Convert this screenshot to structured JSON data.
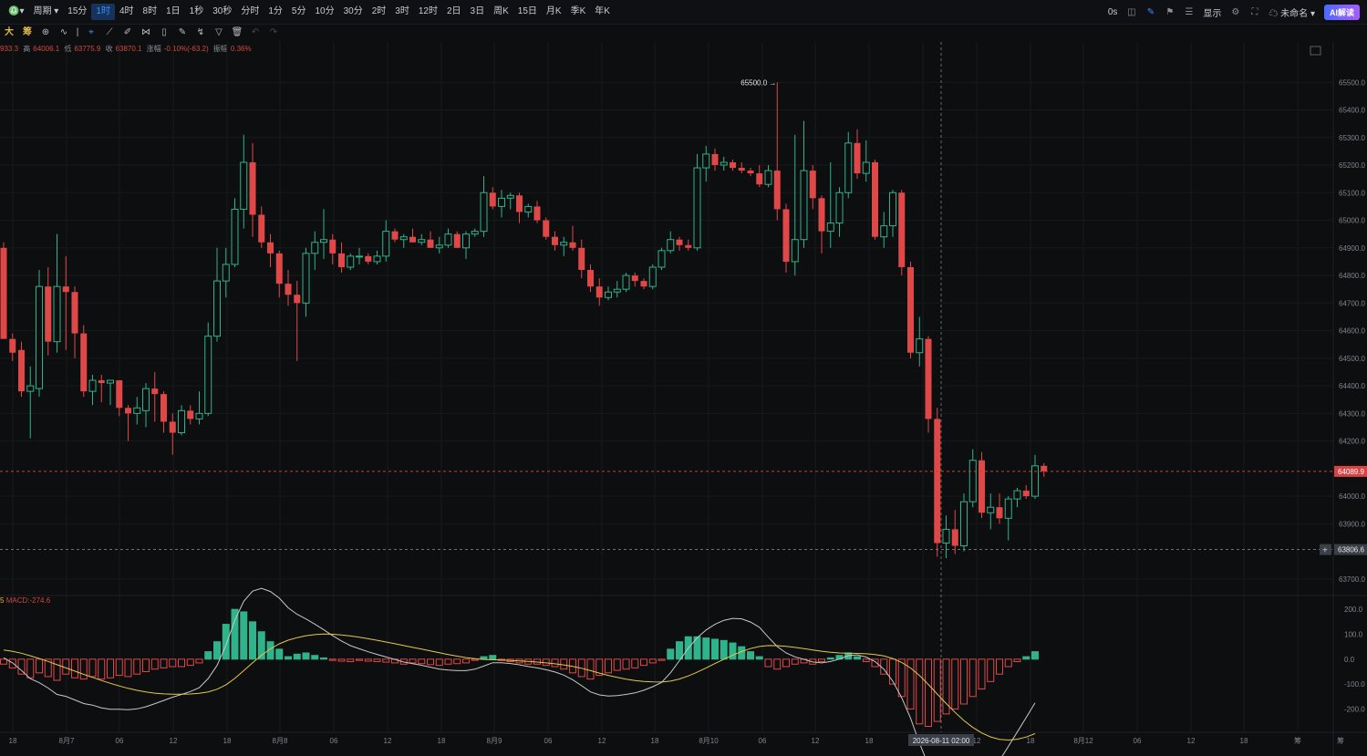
{
  "toolbar": {
    "symbol_icon": "chart-type-icon",
    "period_label": "周期",
    "periods": [
      "15分",
      "1时",
      "4时",
      "8时",
      "1日",
      "1秒",
      "30秒",
      "分时",
      "1分",
      "5分",
      "10分",
      "30分",
      "2时",
      "3时",
      "12时",
      "2日",
      "3日",
      "周K",
      "15日",
      "月K",
      "季K",
      "年K"
    ],
    "active_period": "1时"
  },
  "topright": {
    "timer": "0s",
    "display_label": "显示",
    "unnamed_label": "未命名",
    "ai_label": "AI解读"
  },
  "drawing_tools": {
    "big_label": "大",
    "chip_label": "筹"
  },
  "ohlc": {
    "open_value": "933.3",
    "high_label": "高",
    "high_value": "64006.1",
    "low_label": "低",
    "low_value": "63775.9",
    "close_label": "收",
    "close_value": "63870.1",
    "change_label": "涨幅",
    "change_value": "-0.10%(-63.2)",
    "amp_label": "振幅",
    "amp_value": "0.36%"
  },
  "macd": {
    "prefix": "5",
    "label": "MACD:-274.6"
  },
  "price_axis": [
    "65500.0",
    "65400.0",
    "65300.0",
    "65200.0",
    "65100.0",
    "65000.0",
    "64900.0",
    "64800.0",
    "64700.0",
    "64600.0",
    "64500.0",
    "64400.0",
    "64300.0",
    "64200.0",
    "64000.0",
    "63900.0",
    "63700.0"
  ],
  "macd_axis": [
    "200.0",
    "100.0",
    "0.0",
    "-100.0",
    "-200.0"
  ],
  "current_price_tag": "64089.9",
  "crosshair_price_tag": "63806.6",
  "crosshair_time_tag": "2026-08-11 02:00",
  "high_marker": "65500.0",
  "low_marker": "63775.9",
  "time_axis": [
    "18",
    "8月7",
    "06",
    "12",
    "18",
    "8月8",
    "06",
    "12",
    "18",
    "8月9",
    "06",
    "12",
    "18",
    "8月10",
    "06",
    "12",
    "18",
    "06",
    "12",
    "18",
    "8月12",
    "06",
    "12",
    "18",
    "筹",
    "筹"
  ],
  "colors": {
    "up": "#2fb38a",
    "down": "#e04848",
    "dif": "#c8c8c8",
    "dea": "#e6c84a",
    "bg": "#0d0e10"
  },
  "chart_data": {
    "type": "candlestick",
    "interval": "1时",
    "candles": [
      {
        "o": 64900,
        "h": 64920,
        "l": 64600,
        "c": 64570
      },
      {
        "o": 64570,
        "h": 64590,
        "l": 64490,
        "c": 64520
      },
      {
        "o": 64530,
        "h": 64560,
        "l": 64360,
        "c": 64380
      },
      {
        "o": 64380,
        "h": 64470,
        "l": 64210,
        "c": 64400
      },
      {
        "o": 64390,
        "h": 64820,
        "l": 64360,
        "c": 64760
      },
      {
        "o": 64760,
        "h": 64830,
        "l": 64510,
        "c": 64560
      },
      {
        "o": 64560,
        "h": 64950,
        "l": 64520,
        "c": 64760
      },
      {
        "o": 64760,
        "h": 64870,
        "l": 64530,
        "c": 64740
      },
      {
        "o": 64740,
        "h": 64760,
        "l": 64500,
        "c": 64590
      },
      {
        "o": 64590,
        "h": 64620,
        "l": 64360,
        "c": 64380
      },
      {
        "o": 64380,
        "h": 64440,
        "l": 64330,
        "c": 64420
      },
      {
        "o": 64420,
        "h": 64440,
        "l": 64340,
        "c": 64410
      },
      {
        "o": 64410,
        "h": 64420,
        "l": 64330,
        "c": 64420
      },
      {
        "o": 64420,
        "h": 64420,
        "l": 64290,
        "c": 64320
      },
      {
        "o": 64320,
        "h": 64330,
        "l": 64200,
        "c": 64300
      },
      {
        "o": 64300,
        "h": 64360,
        "l": 64260,
        "c": 64320
      },
      {
        "o": 64310,
        "h": 64410,
        "l": 64250,
        "c": 64390
      },
      {
        "o": 64390,
        "h": 64450,
        "l": 64270,
        "c": 64370
      },
      {
        "o": 64370,
        "h": 64380,
        "l": 64230,
        "c": 64270
      },
      {
        "o": 64270,
        "h": 64300,
        "l": 64150,
        "c": 64230
      },
      {
        "o": 64230,
        "h": 64330,
        "l": 64220,
        "c": 64310
      },
      {
        "o": 64310,
        "h": 64330,
        "l": 64260,
        "c": 64280
      },
      {
        "o": 64280,
        "h": 64380,
        "l": 64260,
        "c": 64300
      },
      {
        "o": 64300,
        "h": 64630,
        "l": 64290,
        "c": 64580
      },
      {
        "o": 64580,
        "h": 64900,
        "l": 64560,
        "c": 64780
      },
      {
        "o": 64780,
        "h": 64900,
        "l": 64720,
        "c": 64840
      },
      {
        "o": 64840,
        "h": 65080,
        "l": 64830,
        "c": 65040
      },
      {
        "o": 65040,
        "h": 65310,
        "l": 64970,
        "c": 65210
      },
      {
        "o": 65210,
        "h": 65280,
        "l": 64940,
        "c": 65020
      },
      {
        "o": 65020,
        "h": 65050,
        "l": 64900,
        "c": 64920
      },
      {
        "o": 64920,
        "h": 64950,
        "l": 64830,
        "c": 64880
      },
      {
        "o": 64880,
        "h": 64890,
        "l": 64720,
        "c": 64770
      },
      {
        "o": 64770,
        "h": 64820,
        "l": 64690,
        "c": 64730
      },
      {
        "o": 64730,
        "h": 64780,
        "l": 64490,
        "c": 64700
      },
      {
        "o": 64700,
        "h": 64900,
        "l": 64650,
        "c": 64880
      },
      {
        "o": 64880,
        "h": 64960,
        "l": 64820,
        "c": 64920
      },
      {
        "o": 64920,
        "h": 65040,
        "l": 64860,
        "c": 64930
      },
      {
        "o": 64930,
        "h": 64950,
        "l": 64840,
        "c": 64880
      },
      {
        "o": 64880,
        "h": 64920,
        "l": 64810,
        "c": 64830
      },
      {
        "o": 64830,
        "h": 64880,
        "l": 64820,
        "c": 64870
      },
      {
        "o": 64870,
        "h": 64900,
        "l": 64840,
        "c": 64870
      },
      {
        "o": 64870,
        "h": 64880,
        "l": 64840,
        "c": 64850
      },
      {
        "o": 64850,
        "h": 64890,
        "l": 64840,
        "c": 64870
      },
      {
        "o": 64870,
        "h": 65000,
        "l": 64850,
        "c": 64960
      },
      {
        "o": 64960,
        "h": 64970,
        "l": 64920,
        "c": 64930
      },
      {
        "o": 64930,
        "h": 64950,
        "l": 64900,
        "c": 64940
      },
      {
        "o": 64940,
        "h": 64970,
        "l": 64920,
        "c": 64920
      },
      {
        "o": 64920,
        "h": 64950,
        "l": 64910,
        "c": 64930
      },
      {
        "o": 64930,
        "h": 64960,
        "l": 64900,
        "c": 64900
      },
      {
        "o": 64900,
        "h": 64940,
        "l": 64880,
        "c": 64910
      },
      {
        "o": 64910,
        "h": 64970,
        "l": 64900,
        "c": 64950
      },
      {
        "o": 64950,
        "h": 64960,
        "l": 64900,
        "c": 64900
      },
      {
        "o": 64900,
        "h": 64960,
        "l": 64860,
        "c": 64950
      },
      {
        "o": 64950,
        "h": 64970,
        "l": 64940,
        "c": 64960
      },
      {
        "o": 64960,
        "h": 65160,
        "l": 64940,
        "c": 65100
      },
      {
        "o": 65100,
        "h": 65120,
        "l": 65040,
        "c": 65050
      },
      {
        "o": 65050,
        "h": 65110,
        "l": 65010,
        "c": 65080
      },
      {
        "o": 65080,
        "h": 65100,
        "l": 65040,
        "c": 65090
      },
      {
        "o": 65090,
        "h": 65100,
        "l": 64990,
        "c": 65030
      },
      {
        "o": 65030,
        "h": 65060,
        "l": 65010,
        "c": 65050
      },
      {
        "o": 65050,
        "h": 65070,
        "l": 64990,
        "c": 65000
      },
      {
        "o": 65000,
        "h": 65010,
        "l": 64930,
        "c": 64940
      },
      {
        "o": 64940,
        "h": 64960,
        "l": 64890,
        "c": 64910
      },
      {
        "o": 64910,
        "h": 64940,
        "l": 64870,
        "c": 64920
      },
      {
        "o": 64920,
        "h": 64980,
        "l": 64890,
        "c": 64900
      },
      {
        "o": 64900,
        "h": 64930,
        "l": 64790,
        "c": 64820
      },
      {
        "o": 64820,
        "h": 64840,
        "l": 64740,
        "c": 64760
      },
      {
        "o": 64760,
        "h": 64790,
        "l": 64690,
        "c": 64720
      },
      {
        "o": 64720,
        "h": 64760,
        "l": 64710,
        "c": 64740
      },
      {
        "o": 64740,
        "h": 64780,
        "l": 64720,
        "c": 64750
      },
      {
        "o": 64750,
        "h": 64810,
        "l": 64740,
        "c": 64800
      },
      {
        "o": 64800,
        "h": 64810,
        "l": 64760,
        "c": 64780
      },
      {
        "o": 64780,
        "h": 64790,
        "l": 64750,
        "c": 64760
      },
      {
        "o": 64760,
        "h": 64840,
        "l": 64750,
        "c": 64830
      },
      {
        "o": 64830,
        "h": 64900,
        "l": 64820,
        "c": 64890
      },
      {
        "o": 64890,
        "h": 64960,
        "l": 64880,
        "c": 64930
      },
      {
        "o": 64930,
        "h": 64940,
        "l": 64890,
        "c": 64910
      },
      {
        "o": 64910,
        "h": 64930,
        "l": 64890,
        "c": 64900
      },
      {
        "o": 64900,
        "h": 65240,
        "l": 64890,
        "c": 65190
      },
      {
        "o": 65190,
        "h": 65270,
        "l": 65140,
        "c": 65240
      },
      {
        "o": 65240,
        "h": 65260,
        "l": 65180,
        "c": 65200
      },
      {
        "o": 65200,
        "h": 65230,
        "l": 65180,
        "c": 65210
      },
      {
        "o": 65210,
        "h": 65220,
        "l": 65180,
        "c": 65190
      },
      {
        "o": 65190,
        "h": 65210,
        "l": 65170,
        "c": 65180
      },
      {
        "o": 65180,
        "h": 65190,
        "l": 65160,
        "c": 65170
      },
      {
        "o": 65170,
        "h": 65200,
        "l": 65120,
        "c": 65130
      },
      {
        "o": 65130,
        "h": 65200,
        "l": 65120,
        "c": 65180
      },
      {
        "o": 65180,
        "h": 65500,
        "l": 65000,
        "c": 65040
      },
      {
        "o": 65040,
        "h": 65060,
        "l": 64810,
        "c": 64850
      },
      {
        "o": 64850,
        "h": 65310,
        "l": 64800,
        "c": 64930
      },
      {
        "o": 64930,
        "h": 65360,
        "l": 64900,
        "c": 65180
      },
      {
        "o": 65180,
        "h": 65200,
        "l": 65040,
        "c": 65080
      },
      {
        "o": 65080,
        "h": 65090,
        "l": 64880,
        "c": 64960
      },
      {
        "o": 64960,
        "h": 65210,
        "l": 64900,
        "c": 64990
      },
      {
        "o": 64990,
        "h": 65120,
        "l": 64940,
        "c": 65100
      },
      {
        "o": 65100,
        "h": 65320,
        "l": 65080,
        "c": 65280
      },
      {
        "o": 65280,
        "h": 65330,
        "l": 65150,
        "c": 65170
      },
      {
        "o": 65170,
        "h": 65290,
        "l": 65140,
        "c": 65210
      },
      {
        "o": 65210,
        "h": 65220,
        "l": 64930,
        "c": 64940
      },
      {
        "o": 64940,
        "h": 65030,
        "l": 64900,
        "c": 64980
      },
      {
        "o": 64980,
        "h": 65110,
        "l": 64940,
        "c": 65100
      },
      {
        "o": 65100,
        "h": 65110,
        "l": 64800,
        "c": 64830
      },
      {
        "o": 64830,
        "h": 64850,
        "l": 64500,
        "c": 64520
      },
      {
        "o": 64520,
        "h": 64650,
        "l": 64470,
        "c": 64570
      },
      {
        "o": 64570,
        "h": 64580,
        "l": 64230,
        "c": 64280
      },
      {
        "o": 64280,
        "h": 64320,
        "l": 63780,
        "c": 63830
      },
      {
        "o": 63830,
        "h": 63930,
        "l": 63775,
        "c": 63880
      },
      {
        "o": 63880,
        "h": 63950,
        "l": 63790,
        "c": 63820
      },
      {
        "o": 63820,
        "h": 64010,
        "l": 63800,
        "c": 63980
      },
      {
        "o": 63980,
        "h": 64170,
        "l": 63960,
        "c": 64130
      },
      {
        "o": 64130,
        "h": 64160,
        "l": 63920,
        "c": 63940
      },
      {
        "o": 63940,
        "h": 64010,
        "l": 63880,
        "c": 63960
      },
      {
        "o": 63960,
        "h": 64010,
        "l": 63900,
        "c": 63920
      },
      {
        "o": 63920,
        "h": 64000,
        "l": 63840,
        "c": 63990
      },
      {
        "o": 63990,
        "h": 64030,
        "l": 63960,
        "c": 64020
      },
      {
        "o": 64020,
        "h": 64040,
        "l": 63990,
        "c": 64000
      },
      {
        "o": 64000,
        "h": 64150,
        "l": 63990,
        "c": 64110
      },
      {
        "o": 64110,
        "h": 64120,
        "l": 64070,
        "c": 64090
      }
    ],
    "macd_hist": [
      -20,
      -35,
      -60,
      -75,
      -55,
      -70,
      -85,
      -60,
      -75,
      -80,
      -70,
      -80,
      -75,
      -65,
      -70,
      -60,
      -50,
      -40,
      -35,
      -30,
      -30,
      -25,
      -15,
      30,
      70,
      140,
      200,
      190,
      150,
      110,
      70,
      40,
      10,
      20,
      25,
      15,
      5,
      -5,
      -8,
      -10,
      -5,
      -8,
      -10,
      -12,
      -15,
      -20,
      -15,
      -18,
      -22,
      -25,
      -20,
      -18,
      -15,
      -5,
      10,
      15,
      -5,
      -10,
      -15,
      -20,
      -20,
      -25,
      -30,
      -40,
      -55,
      -70,
      -80,
      -65,
      -55,
      -45,
      -40,
      -35,
      -25,
      -15,
      -5,
      40,
      70,
      90,
      90,
      85,
      80,
      75,
      65,
      50,
      30,
      10,
      -30,
      -40,
      -30,
      -20,
      -15,
      -20,
      -10,
      5,
      15,
      25,
      10,
      -10,
      -30,
      -60,
      -100,
      -150,
      -200,
      -260,
      -270,
      -250,
      -220,
      -200,
      -180,
      -150,
      -120,
      -90,
      -60,
      -30,
      -10,
      10,
      30
    ],
    "macd_ylim": [
      -290,
      230
    ],
    "price_ylim": [
      63650,
      65600
    ]
  }
}
